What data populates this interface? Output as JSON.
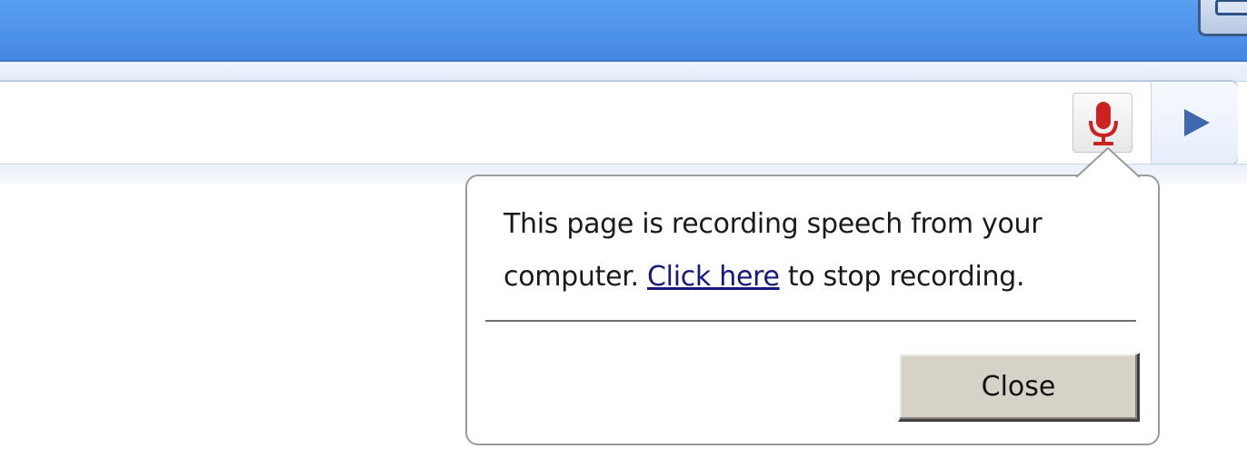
{
  "icons": {
    "mic": "microphone-icon",
    "go": "play-arrow-icon",
    "window_control": "window-button-icon"
  },
  "colors": {
    "titlebar": "#4a8ee8",
    "mic_red": "#cc2222",
    "go_arrow": "#3f68b0",
    "link": "#17177e",
    "close_button_face": "#d7d2c8"
  },
  "bubble": {
    "line1": "This page is recording speech from your",
    "line2_prefix": "computer. ",
    "link_text": "Click here",
    "line2_suffix": " to stop recording.",
    "close_label": "Close"
  }
}
